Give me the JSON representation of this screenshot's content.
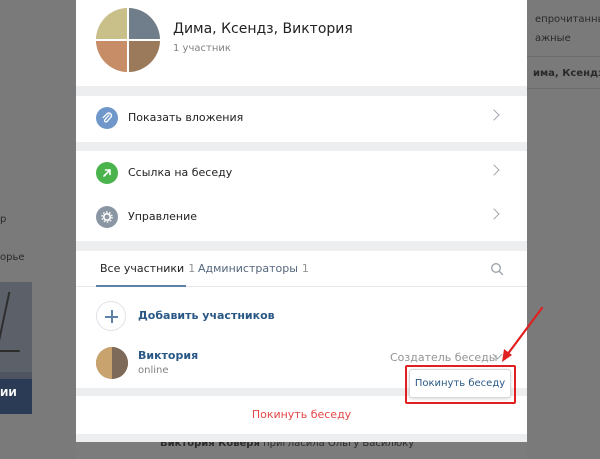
{
  "background": {
    "left_fragments": [
      "p",
      "орье"
    ],
    "left_strip": "ИИ",
    "right_fragments": [
      "епрочитанные",
      "ажные",
      "има, Ксендз, В"
    ],
    "bottom_line": {
      "bold": "Виктория Коверя",
      "rest": " пригласила Ольгу Василюку"
    }
  },
  "header": {
    "title": "Дима, Ксендз, Виктория",
    "subtitle": "1 участник"
  },
  "actions": {
    "attachments": "Показать вложения",
    "chat_link": "Ссылка на беседу",
    "manage": "Управление"
  },
  "tabs": {
    "all": {
      "label": "Все участники",
      "count": "1"
    },
    "admins": {
      "label": "Администраторы",
      "count": "1"
    }
  },
  "add_members": "Добавить участников",
  "member": {
    "name": "Виктория",
    "status": "online",
    "role": "Создатель беседы"
  },
  "dropdown": {
    "leave": "Покинуть беседу"
  },
  "footer": {
    "leave": "Покинуть беседу"
  },
  "colors": {
    "accent": "#2a5885",
    "danger": "#e64646",
    "highlight": "#e02020"
  }
}
